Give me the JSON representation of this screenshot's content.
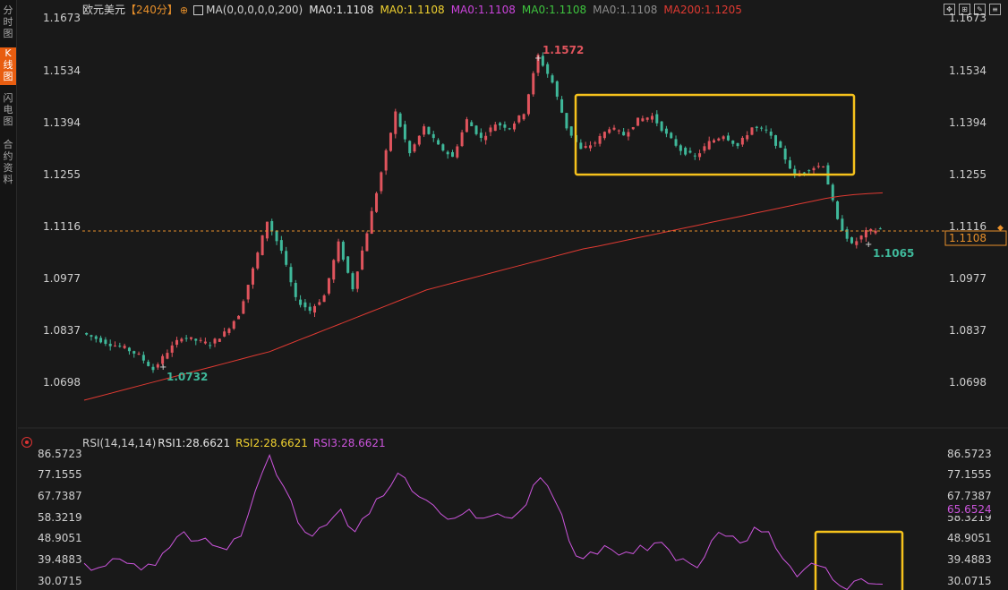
{
  "sidebar": {
    "items": [
      {
        "label": "分时图"
      },
      {
        "label": "K线图"
      },
      {
        "label": "闪电图"
      },
      {
        "label": "合约资料"
      }
    ]
  },
  "header": {
    "symbol": "欧元美元",
    "period": "【240分】",
    "ma_params": "MA(0,0,0,0,0,200)",
    "ma1": "MA0:1.1108",
    "ma2": "MA0:1.1108",
    "ma3": "MA0:1.1108",
    "ma4": "MA0:1.1108",
    "ma5": "MA0:1.1108",
    "ma200": "MA200:1.1205"
  },
  "price_axis": {
    "left_ticks": [
      "1.1673",
      "1.1534",
      "1.1394",
      "1.1255",
      "1.1116",
      "1.0977",
      "1.0837",
      "1.0698"
    ],
    "right_ticks": [
      "1.1673",
      "1.1534",
      "1.1394",
      "1.1255",
      "1.1116",
      "1.0977",
      "1.0837",
      "1.0698"
    ],
    "current_price": "1.1108"
  },
  "annotations": {
    "high": "1.1572",
    "low": "1.0732",
    "recent_low": "1.1065"
  },
  "rsi": {
    "params": "RSI(14,14,14)",
    "rsi1": "RSI1:28.6621",
    "rsi2": "RSI2:28.6621",
    "rsi3": "RSI3:28.6621",
    "left_ticks": [
      "86.5723",
      "77.1555",
      "67.7387",
      "58.3219",
      "48.9051",
      "39.4883",
      "30.0715"
    ],
    "right_ticks": [
      "86.5723",
      "77.1555",
      "67.7387",
      "58.3219",
      "48.9051",
      "39.4883",
      "30.0715"
    ],
    "current": "65.6524"
  },
  "colors": {
    "up": "#e0545d",
    "down": "#3fb89a",
    "ma200": "#e03a32",
    "rsi": "#cc55dd",
    "highlight_box": "#f6c21c",
    "price_line": "#e8902a"
  },
  "chart_data": {
    "type": "line",
    "series": [
      {
        "name": "欧元美元",
        "values": [
          1.083,
          1.0815,
          1.08,
          1.079,
          1.077,
          1.0732,
          1.078,
          1.082,
          1.081,
          1.08,
          1.083,
          1.088,
          1.1,
          1.113,
          1.105,
          1.092,
          1.089,
          1.093,
          1.107,
          1.095,
          1.11,
          1.126,
          1.142,
          1.131,
          1.138,
          1.133,
          1.13,
          1.14,
          1.135,
          1.139,
          1.138,
          1.142,
          1.1572,
          1.15,
          1.138,
          1.132,
          1.134,
          1.138,
          1.136,
          1.14,
          1.141,
          1.136,
          1.132,
          1.13,
          1.134,
          1.136,
          1.133,
          1.138,
          1.137,
          1.132,
          1.125,
          1.127,
          1.128,
          1.113,
          1.1065,
          1.11,
          1.1108
        ]
      },
      {
        "name": "MA200",
        "values": [
          1.065,
          1.066,
          1.067,
          1.068,
          1.069,
          1.07,
          1.071,
          1.072,
          1.073,
          1.074,
          1.075,
          1.076,
          1.077,
          1.078,
          1.0795,
          1.081,
          1.0825,
          1.084,
          1.0855,
          1.087,
          1.0885,
          1.09,
          1.0915,
          1.093,
          1.0945,
          1.0955,
          1.0965,
          1.0975,
          1.0985,
          1.0995,
          1.1005,
          1.1015,
          1.1025,
          1.1035,
          1.1045,
          1.1055,
          1.1062,
          1.107,
          1.1078,
          1.1086,
          1.1094,
          1.1102,
          1.111,
          1.1118,
          1.1126,
          1.1134,
          1.1142,
          1.115,
          1.1158,
          1.1166,
          1.1174,
          1.1182,
          1.119,
          1.1196,
          1.12,
          1.1203,
          1.1205
        ]
      },
      {
        "name": "RSI1",
        "values": [
          38,
          36,
          40,
          38,
          35,
          37,
          45,
          52,
          48,
          46,
          44,
          50,
          70,
          86,
          72,
          56,
          50,
          55,
          62,
          52,
          60,
          68,
          78,
          70,
          66,
          60,
          58,
          62,
          58,
          60,
          58,
          64,
          76,
          66,
          48,
          40,
          42,
          44,
          43,
          46,
          47,
          44,
          40,
          36,
          48,
          50,
          47,
          54,
          52,
          40,
          32,
          38,
          36,
          28,
          30,
          29,
          28.66
        ]
      }
    ],
    "title": "",
    "xlabel": "",
    "ylabel": "",
    "ylim": [
      1.064,
      1.169
    ],
    "rsi_ylim": [
      28,
      88
    ],
    "grid": false
  }
}
